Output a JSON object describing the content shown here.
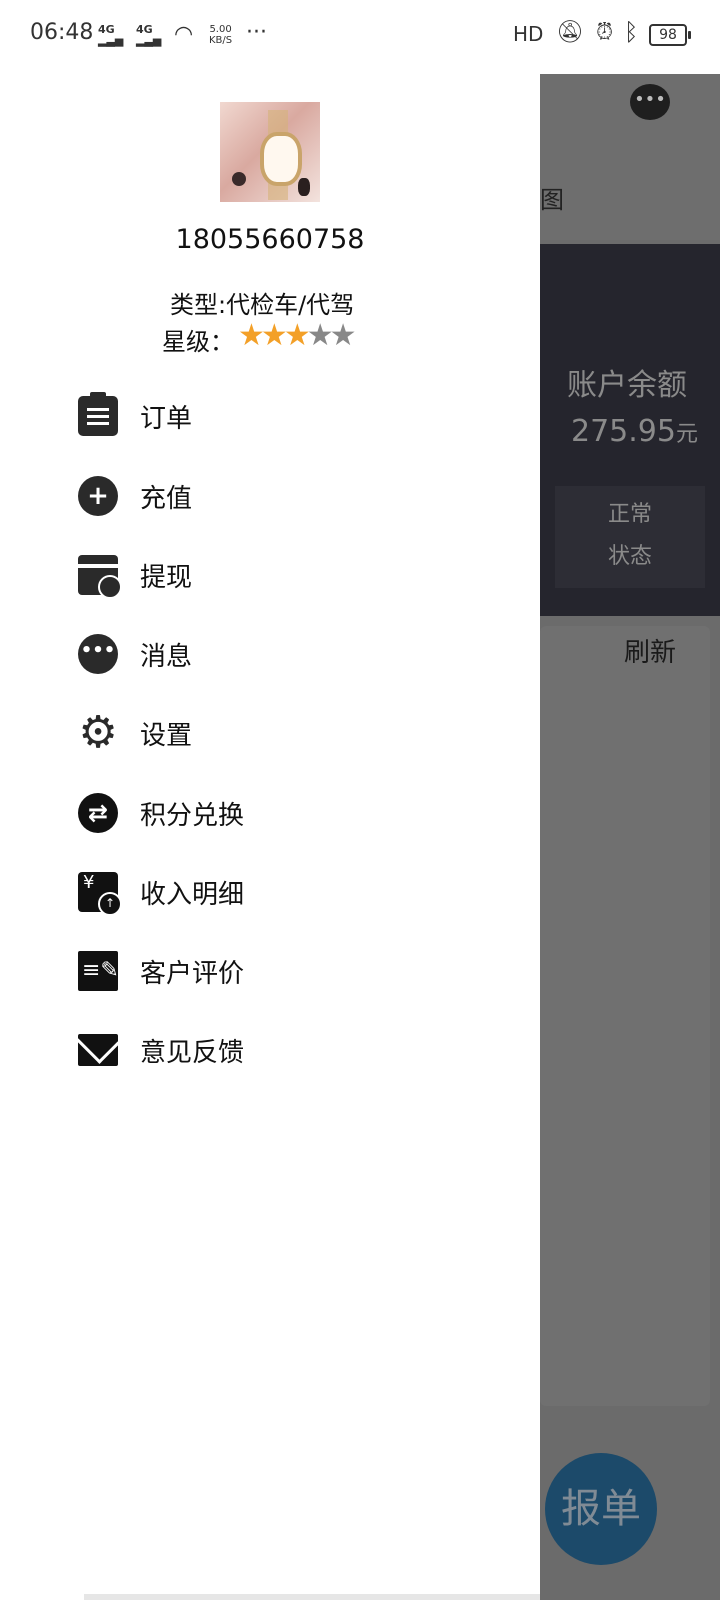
{
  "status_bar": {
    "time": "06:48",
    "signal1": "4G",
    "signal2": "4G",
    "speed_value": "5.00",
    "speed_unit": "KB/S",
    "more": "···",
    "hd": "HD",
    "battery": "98"
  },
  "drawer": {
    "phone": "18055660758",
    "type": "类型:代检车/代驾",
    "level_label": "星级：",
    "stars_filled": 3,
    "stars_total": 5,
    "menu": [
      {
        "label": "订单",
        "icon": "clipboard-icon"
      },
      {
        "label": "充值",
        "icon": "plus-circle-icon"
      },
      {
        "label": "提现",
        "icon": "card-withdraw-icon"
      },
      {
        "label": "消息",
        "icon": "message-icon"
      },
      {
        "label": "设置",
        "icon": "gear-icon"
      },
      {
        "label": "积分兑换",
        "icon": "exchange-icon"
      },
      {
        "label": "收入明细",
        "icon": "income-icon"
      },
      {
        "label": "客户评价",
        "icon": "edit-icon"
      },
      {
        "label": "意见反馈",
        "icon": "mail-icon"
      }
    ]
  },
  "background": {
    "header_partial": "图",
    "balance_label": "账户余额",
    "balance_value": "275.95",
    "balance_unit": "元",
    "status_line1": "正常",
    "status_line2": "状态",
    "refresh": "刷新",
    "fab": "报单"
  }
}
